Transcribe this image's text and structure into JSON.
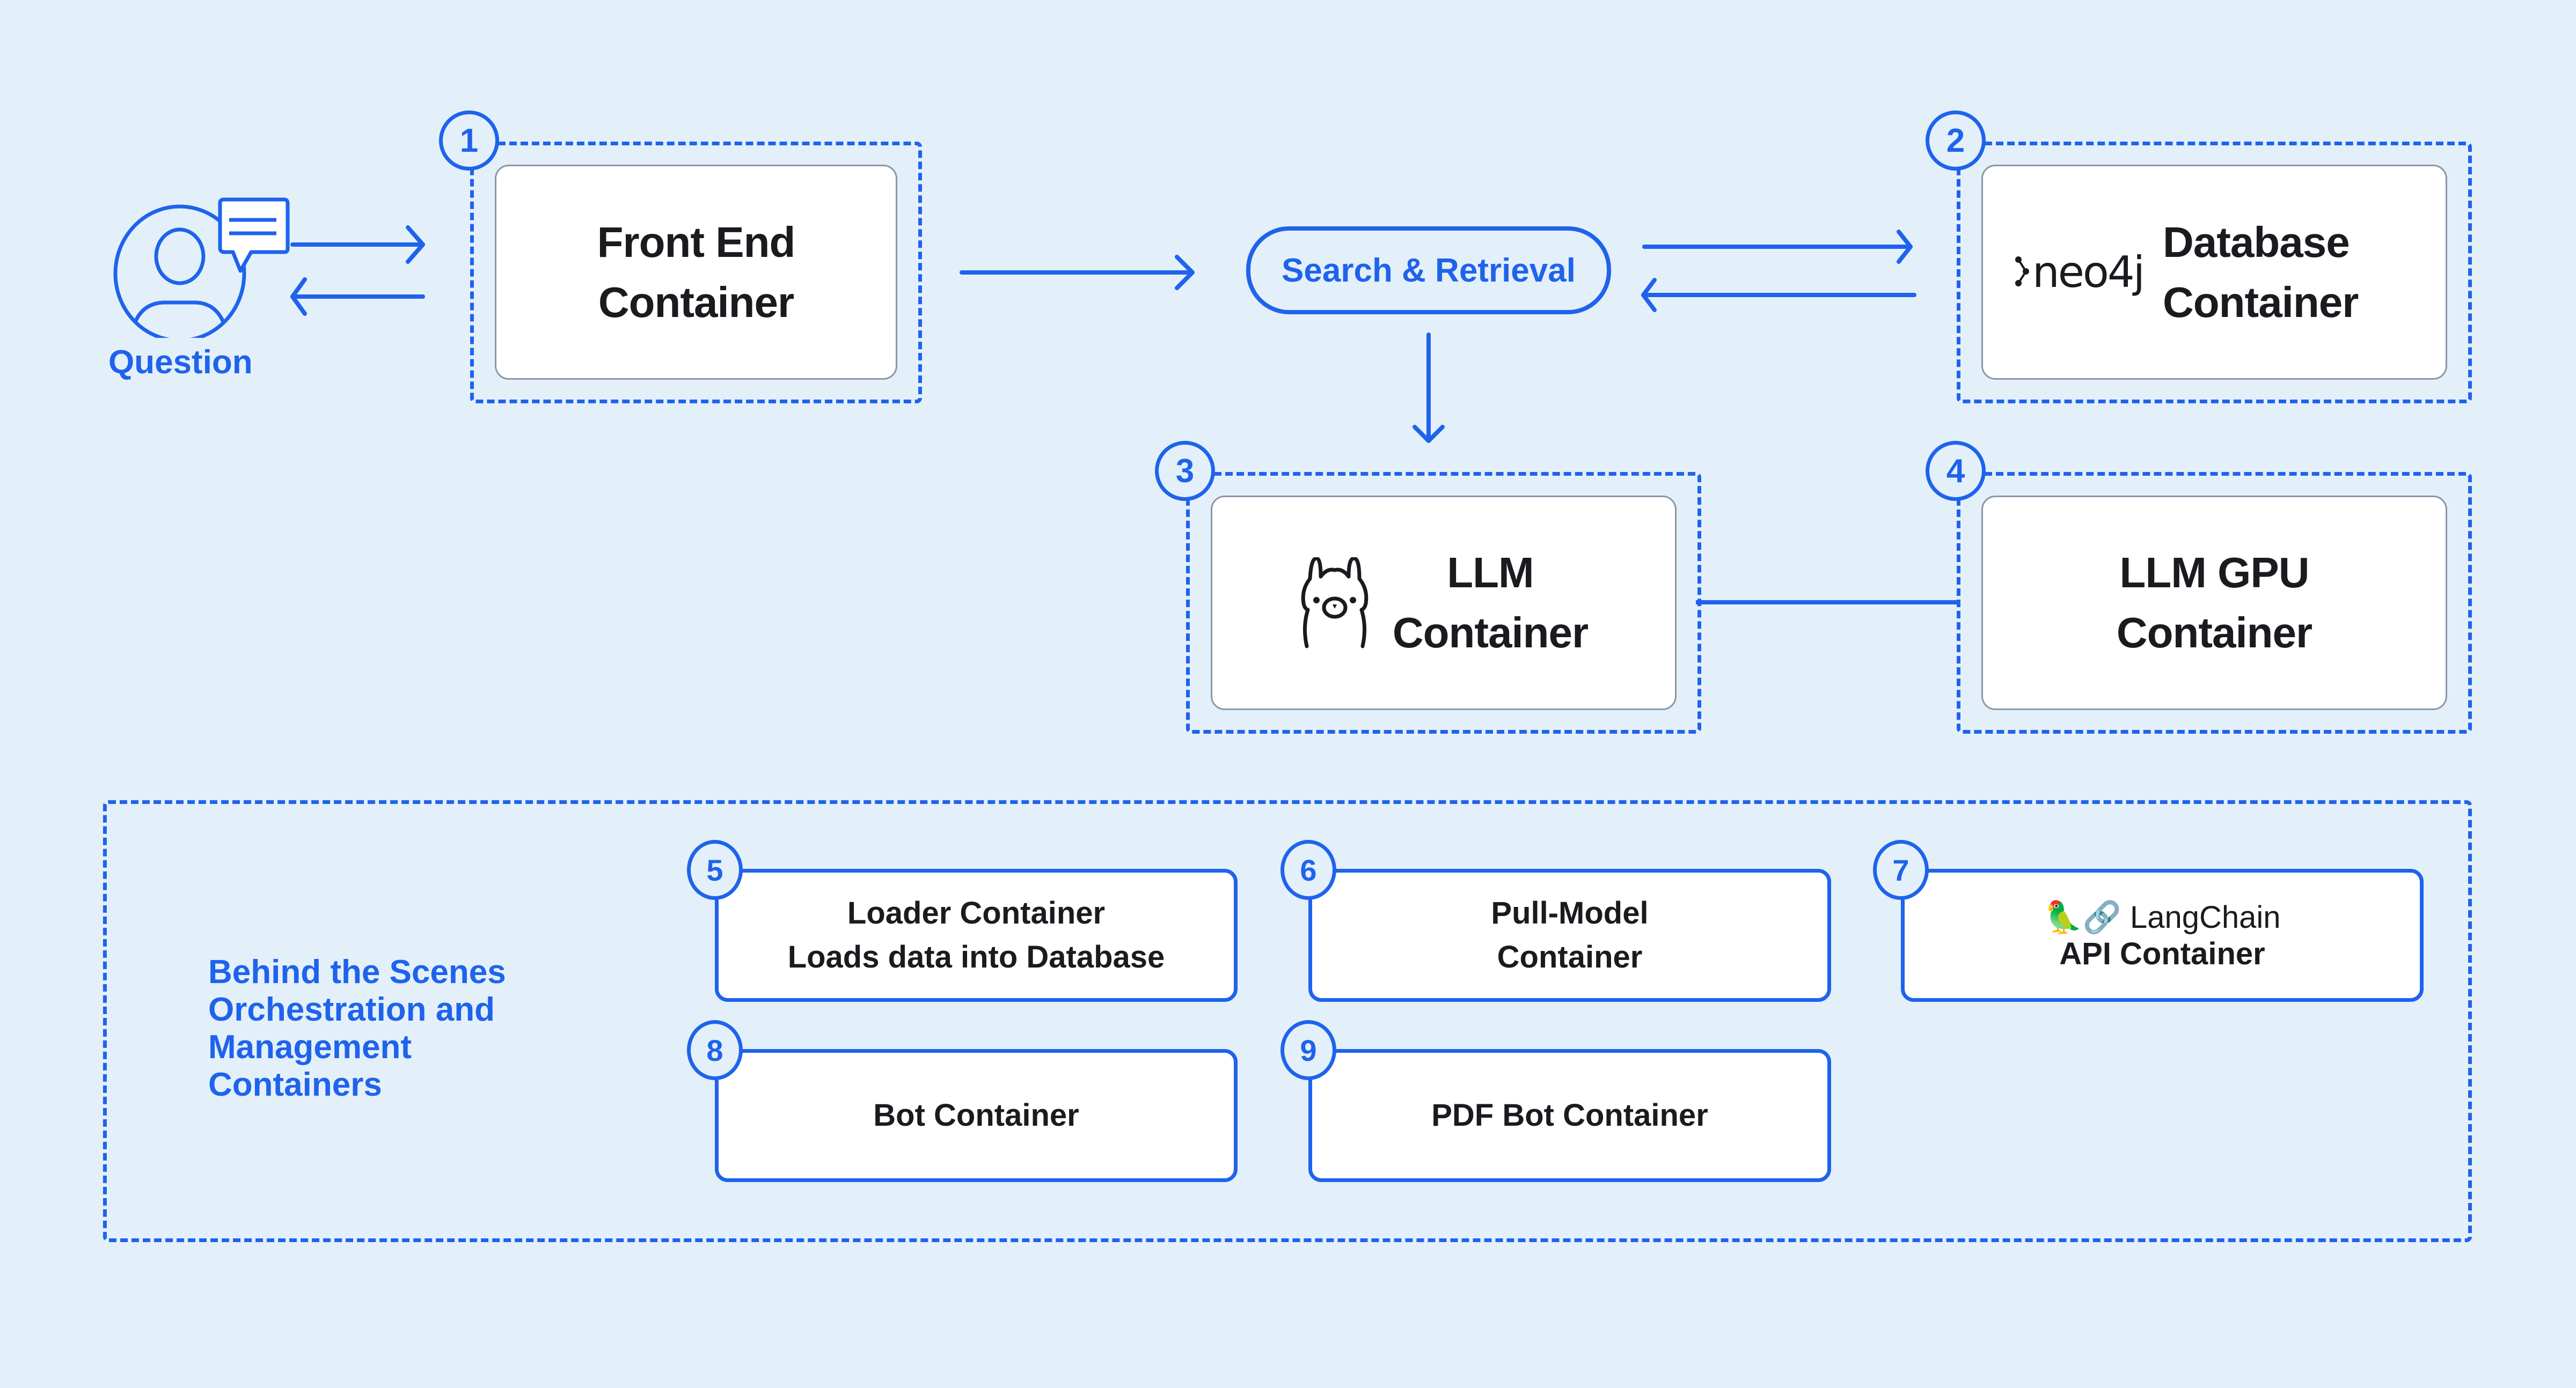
{
  "diagram": {
    "accent_color": "#1f63ec",
    "background_color": "#e3f0fa",
    "text_color": "#1a1b1f",
    "user": {
      "label": "Question",
      "icon": "user-chat-icon"
    },
    "search": {
      "label": "Search & Retrieval"
    },
    "containers": [
      {
        "number": "1",
        "line1": "Front End",
        "line2": "Container",
        "logo": ""
      },
      {
        "number": "2",
        "line1": "Database",
        "line2": "Container",
        "logo": "neo4j"
      },
      {
        "number": "3",
        "line1": "LLM",
        "line2": "Container",
        "logo": "llama-icon"
      },
      {
        "number": "4",
        "line1": "LLM GPU",
        "line2": "Container",
        "logo": ""
      }
    ],
    "behind_the_scenes": {
      "title_lines": [
        "Behind the Scenes",
        "Orchestration and",
        "Management",
        "Containers"
      ],
      "items": [
        {
          "number": "5",
          "line1": "Loader Container",
          "line2": "Loads data into Database"
        },
        {
          "number": "6",
          "line1": "Pull-Model",
          "line2": "Container"
        },
        {
          "number": "7",
          "logo_text": "🦜🔗 LangChain",
          "line2": "API Container"
        },
        {
          "number": "8",
          "line1": "Bot Container"
        },
        {
          "number": "9",
          "line1": "PDF Bot Container"
        }
      ]
    },
    "edges": [
      {
        "from": "Question",
        "to": "Front End Container",
        "direction": "bidirectional"
      },
      {
        "from": "Front End Container",
        "to": "Search & Retrieval",
        "direction": "forward"
      },
      {
        "from": "Search & Retrieval",
        "to": "Database Container",
        "direction": "bidirectional"
      },
      {
        "from": "Search & Retrieval",
        "to": "LLM Container",
        "direction": "forward"
      },
      {
        "from": "LLM Container",
        "to": "LLM GPU Container",
        "direction": "none"
      }
    ]
  }
}
